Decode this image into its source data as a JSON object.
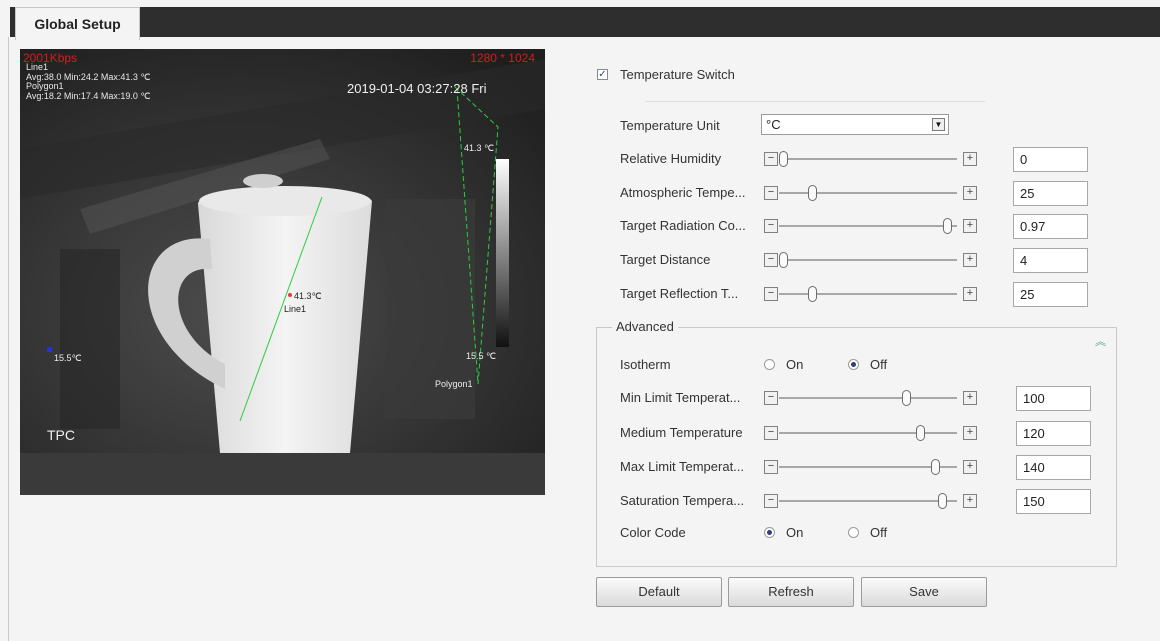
{
  "tabs": [
    {
      "label": "Global Setup",
      "active": true
    }
  ],
  "video": {
    "bitrate": "2001Kbps",
    "resolution": "1280 * 1024",
    "timestamp": "2019-01-04 03:27:28 Fri",
    "line1_name": "Line1",
    "line1_stats": "Avg:38.0 Min:24.2 Max:41.3 ℃",
    "polygon1_name": "Polygon1",
    "polygon1_stats": "Avg:18.2 Min:17.4 Max:19.0 ℃",
    "scale_max": "41.3 ℃",
    "scale_min": "15.5 ℃",
    "left_temp": "15.5℃",
    "cup_temp": "41.3℃",
    "line_label": "Line1",
    "polygon_label": "Polygon1",
    "channel_name": "TPC"
  },
  "settings": {
    "temperature_switch": {
      "label": "Temperature Switch",
      "checked": true
    },
    "temperature_unit": {
      "label": "Temperature Unit",
      "value": "°C"
    },
    "sliders": [
      {
        "label": "Relative Humidity",
        "value": "0",
        "fraction": 0.0
      },
      {
        "label": "Atmospheric Tempe...",
        "value": "25",
        "fraction": 0.17
      },
      {
        "label": "Target Radiation Co...",
        "value": "0.97",
        "fraction": 0.97
      },
      {
        "label": "Target Distance",
        "value": "4",
        "fraction": 0.0
      },
      {
        "label": "Target Reflection T...",
        "value": "25",
        "fraction": 0.17
      }
    ]
  },
  "advanced": {
    "title": "Advanced",
    "isotherm": {
      "label": "Isotherm",
      "on_label": "On",
      "off_label": "Off",
      "selected": "Off"
    },
    "sliders": [
      {
        "label": "Min Limit Temperat...",
        "value": "100",
        "fraction": 0.73
      },
      {
        "label": "Medium Temperature",
        "value": "120",
        "fraction": 0.81
      },
      {
        "label": "Max Limit Temperat...",
        "value": "140",
        "fraction": 0.9
      },
      {
        "label": "Saturation Tempera...",
        "value": "150",
        "fraction": 0.94
      }
    ],
    "color_code": {
      "label": "Color Code",
      "on_label": "On",
      "off_label": "Off",
      "selected": "On"
    }
  },
  "buttons": {
    "default": "Default",
    "refresh": "Refresh",
    "save": "Save"
  },
  "colors": {
    "tab_bar": "#2e2e2e",
    "overlay_red": "#d81b1b",
    "line_green": "#2ecc40",
    "radio_dot": "#2d3f7f"
  }
}
